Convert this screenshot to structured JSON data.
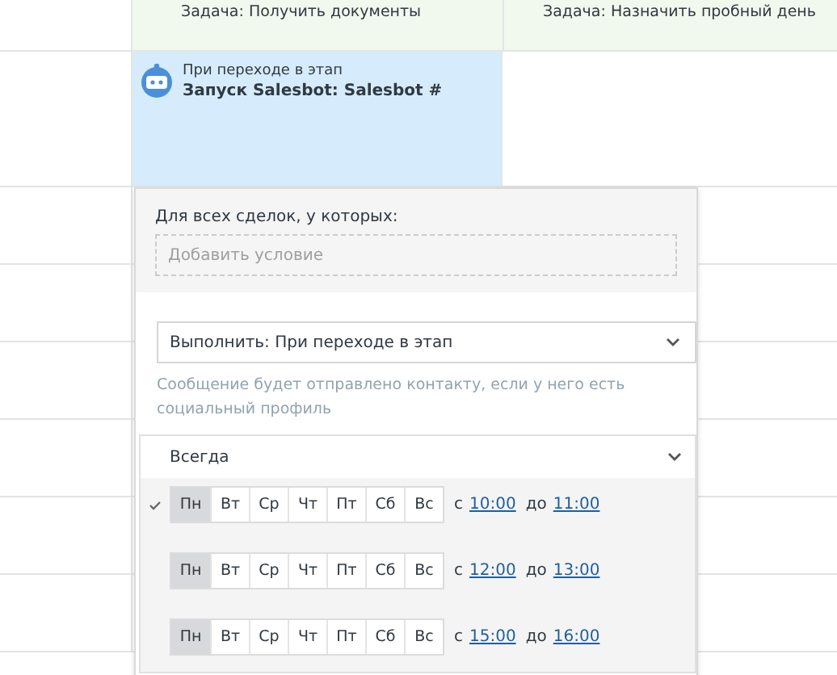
{
  "top_row": {
    "cell_1": "Задача: Получить документы",
    "cell_2": "Задача: Назначить пробный день"
  },
  "trigger_card": {
    "caption": "При переходе в этап",
    "title": "Запуск Salesbot: Salesbot #"
  },
  "popup": {
    "condition_label": "Для всех сделок, у которых:",
    "condition_placeholder": "Добавить условие",
    "execute_select": "Выполнить: При переходе в этап",
    "hint": "Сообщение будет отправлено контакту, если у него есть социальный профиль",
    "schedule": {
      "title": "Всегда",
      "expanded": true,
      "rows": [
        {
          "checked": true,
          "days": [
            {
              "label": "Пн",
              "selected": true
            },
            {
              "label": "Вт",
              "selected": false
            },
            {
              "label": "Ср",
              "selected": false
            },
            {
              "label": "Чт",
              "selected": false
            },
            {
              "label": "Пт",
              "selected": false
            },
            {
              "label": "Сб",
              "selected": false
            },
            {
              "label": "Вс",
              "selected": false
            }
          ],
          "from_label": "с",
          "from": "10:00",
          "to_label": "до",
          "to": "11:00"
        },
        {
          "checked": false,
          "days": [
            {
              "label": "Пн",
              "selected": true
            },
            {
              "label": "Вт",
              "selected": false
            },
            {
              "label": "Ср",
              "selected": false
            },
            {
              "label": "Чт",
              "selected": false
            },
            {
              "label": "Пт",
              "selected": false
            },
            {
              "label": "Сб",
              "selected": false
            },
            {
              "label": "Вс",
              "selected": false
            }
          ],
          "from_label": "с",
          "from": "12:00",
          "to_label": "до",
          "to": "13:00"
        },
        {
          "checked": false,
          "days": [
            {
              "label": "Пн",
              "selected": true
            },
            {
              "label": "Вт",
              "selected": false
            },
            {
              "label": "Ср",
              "selected": false
            },
            {
              "label": "Чт",
              "selected": false
            },
            {
              "label": "Пт",
              "selected": false
            },
            {
              "label": "Сб",
              "selected": false
            },
            {
              "label": "Вс",
              "selected": false
            }
          ],
          "from_label": "с",
          "from": "15:00",
          "to_label": "до",
          "to": "16:00"
        }
      ]
    }
  }
}
